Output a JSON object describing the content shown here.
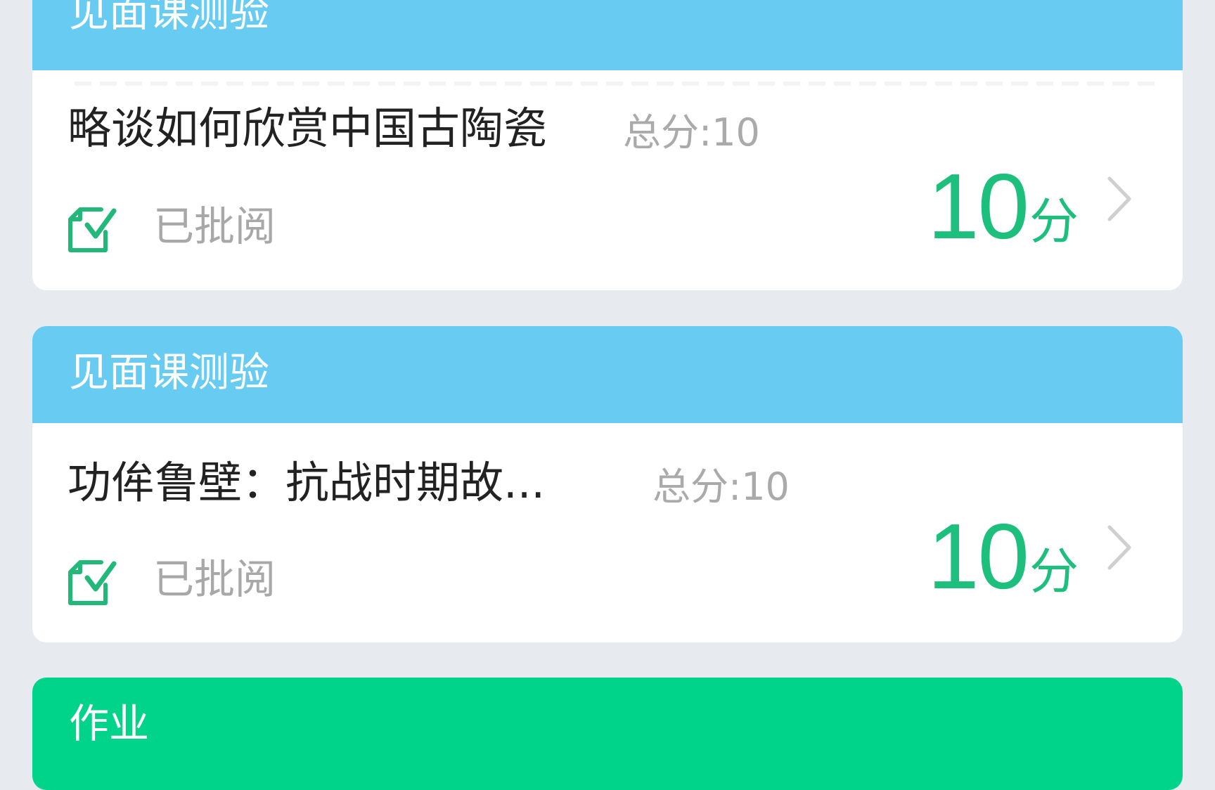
{
  "items": [
    {
      "category": "见面课测验",
      "title": "略谈如何欣赏中国古陶瓷",
      "total_label": "总分:10",
      "status": "已批阅",
      "score_value": "10",
      "score_unit": "分"
    },
    {
      "category": "见面课测验",
      "title": "功侔鲁壁：抗战时期故...",
      "total_label": "总分:10",
      "status": "已批阅",
      "score_value": "10",
      "score_unit": "分"
    },
    {
      "category": "作业"
    }
  ],
  "colors": {
    "page_background": "#e7ebf0",
    "quiz_header": "#67cbf2",
    "homework_header": "#00d38a",
    "score_green": "#1dbf7d",
    "muted_text": "#aaaaaa"
  },
  "icons": {
    "status": "graded-document-check-icon",
    "chevron": "chevron-right-icon"
  }
}
